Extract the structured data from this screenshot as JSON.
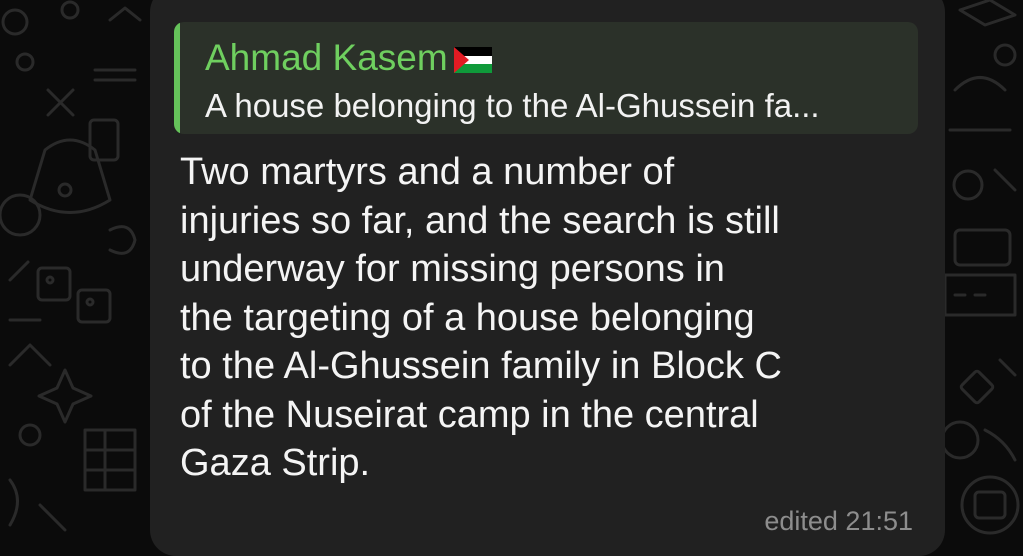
{
  "message": {
    "reply": {
      "author": "Ahmad Kasem",
      "author_flag_icon": "palestine-flag",
      "preview": "A house belonging to the Al-Ghussein fa..."
    },
    "text": "Two martyrs and a number of\ninjuries so far, and the search is still\nunderway for missing persons in\nthe targeting of a house belonging\nto the Al-Ghussein family in Block C\nof the Nuseirat camp in the central\nGaza Strip.",
    "edited_label": "edited",
    "time": "21:51"
  },
  "colors": {
    "background": "#0b0b0b",
    "bubble": "#212121",
    "reply_bg": "#2b3129",
    "reply_accent": "#65c25a",
    "author_name": "#6fcf5f",
    "text": "#f4f4f4",
    "meta": "#8d8d8d"
  }
}
